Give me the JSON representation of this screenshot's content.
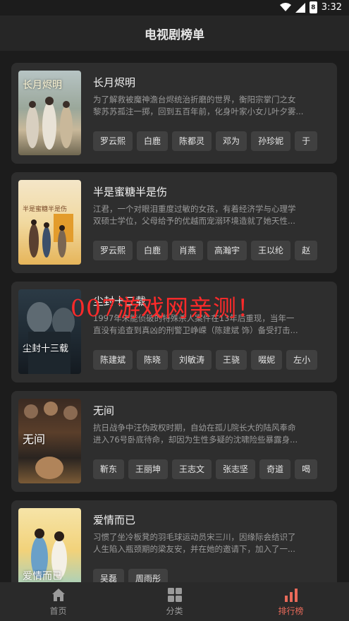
{
  "status_bar": {
    "time": "3:32",
    "battery": "8"
  },
  "header": {
    "title": "电视剧榜单"
  },
  "shows": [
    {
      "title": "长月烬明",
      "poster_text": "长月烬明",
      "desc_line1": "为了解救被魔神澹台烬统治折磨的世界，衡阳宗掌门之女",
      "desc_line2": "黎苏苏孤注一掷，回到五百年前，化身叶家小女儿叶夕雾...",
      "cast": [
        "罗云熙",
        "白鹿",
        "陈都灵",
        "邓为",
        "孙珍妮",
        "于"
      ]
    },
    {
      "title": "半是蜜糖半是伤",
      "poster_text": "半是蜜糖半是伤",
      "desc_line1": "江君，一个对眼泪重度过敏的女孩，有着经济学与心理学",
      "desc_line2": "双硕士学位，父母给予的优越而宠溺环境造就了她天性...",
      "cast": [
        "罗云熙",
        "白鹿",
        "肖燕",
        "高瀚宇",
        "王以纶",
        "赵"
      ]
    },
    {
      "title": "尘封十三载",
      "poster_text": "尘封十三载",
      "desc_line1": "1997年未能侦破的特殊杀人案件在13年后重现，当年一",
      "desc_line2": "直没有追查到真凶的刑警卫峥嵘（陈建斌 饰）备受打击...",
      "cast": [
        "陈建斌",
        "陈晓",
        "刘敏涛",
        "王骁",
        "啜妮",
        "左小"
      ]
    },
    {
      "title": "无间",
      "poster_text": "无间",
      "desc_line1": "抗日战争中汪伪政权时期，自幼在孤儿院长大的陆风奉命",
      "desc_line2": "进入76号卧底待命，却因为生性多疑的沈啸险些暴露身...",
      "cast": [
        "靳东",
        "王丽坤",
        "王志文",
        "张志坚",
        "奇道",
        "喝"
      ]
    },
    {
      "title": "爱情而已",
      "poster_text": "爱情而已",
      "desc_line1": "习惯了坐冷板凳的羽毛球运动员宋三川，因缘际会结识了",
      "desc_line2": "人生陷入瓶颈期的梁友安，并在她的邀请下，加入了一...",
      "cast": [
        "吴磊",
        "周雨彤"
      ]
    }
  ],
  "watermark": "007游戏网亲测！",
  "tabs": [
    {
      "label": "首页",
      "icon": "home-icon"
    },
    {
      "label": "分类",
      "icon": "grid-icon"
    },
    {
      "label": "排行榜",
      "icon": "bar-chart-icon"
    }
  ],
  "colors": {
    "accent": "#e96a5a",
    "background": "#1c1c1c",
    "card": "#2e2e2e"
  }
}
